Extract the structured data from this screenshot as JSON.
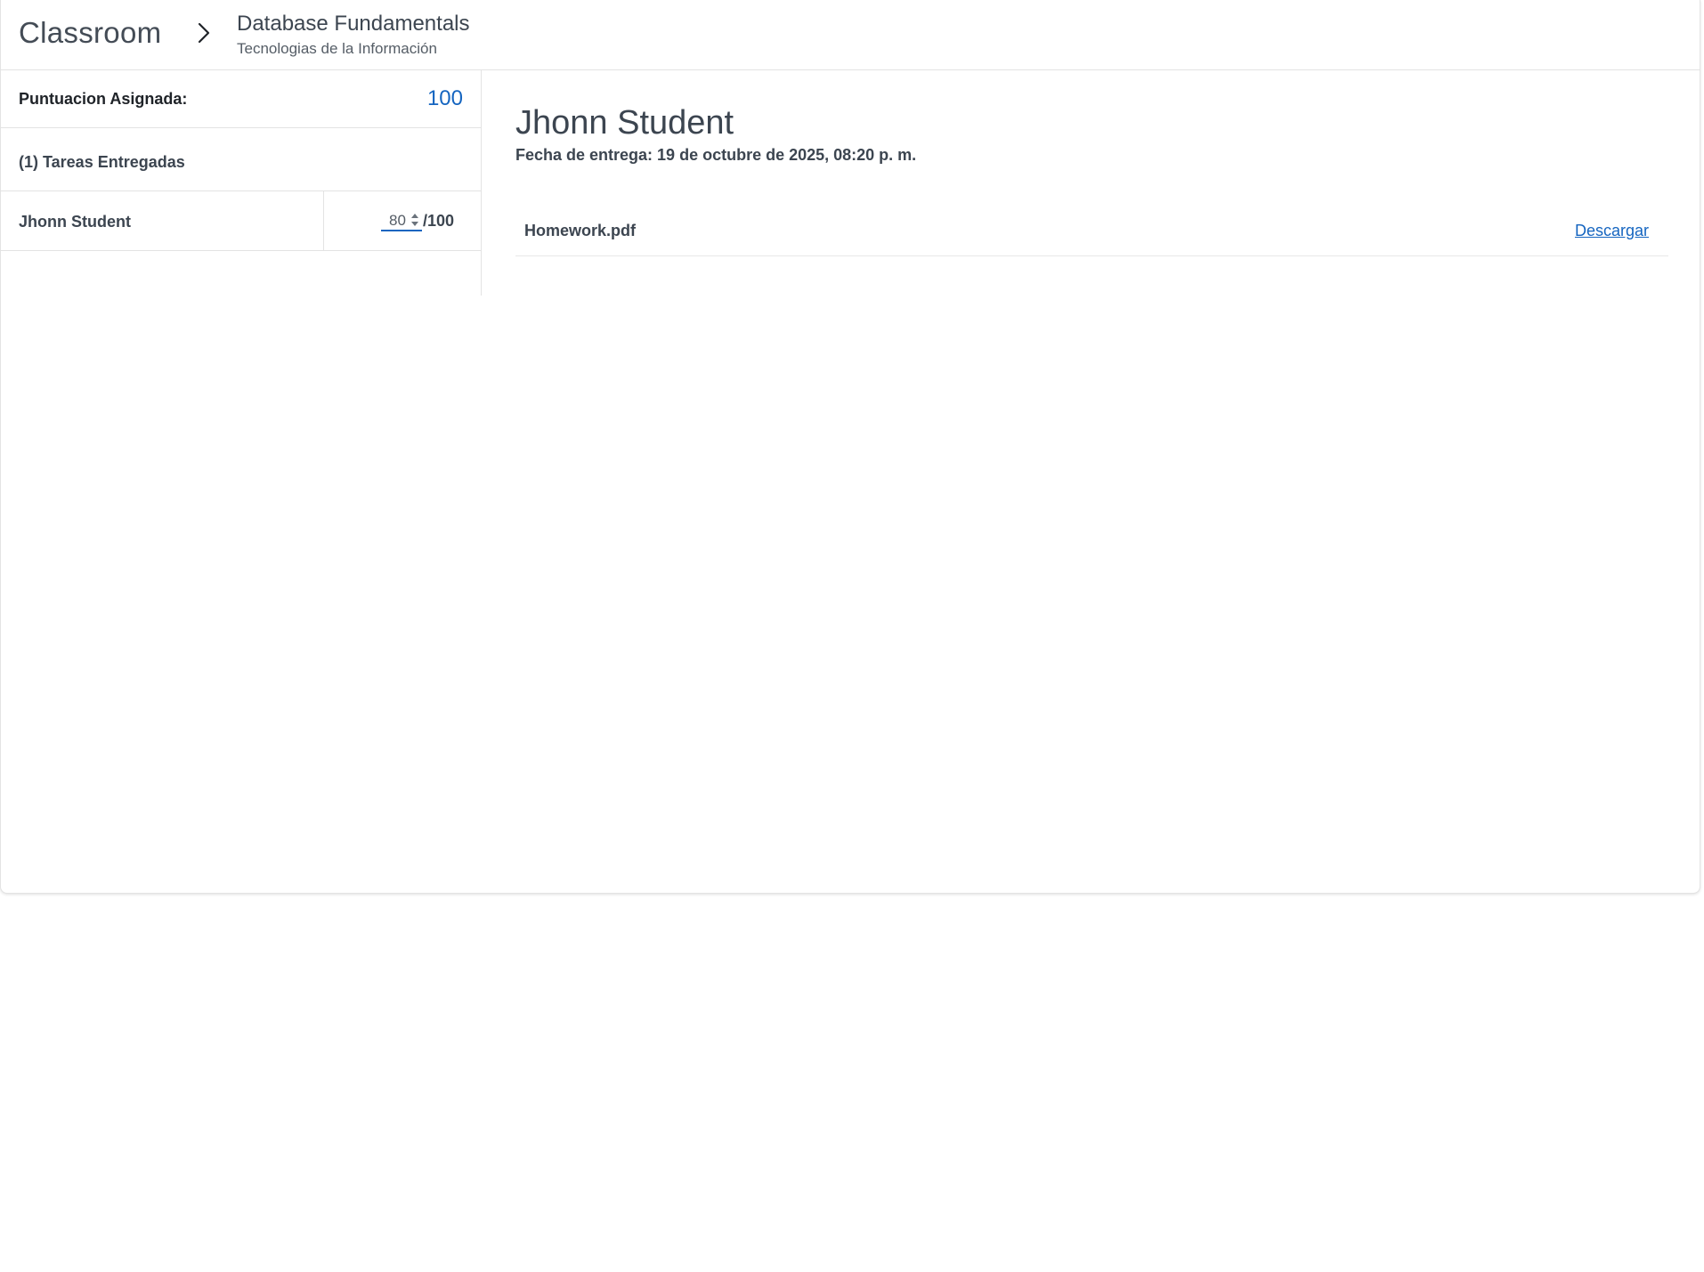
{
  "header": {
    "brand": "Classroom",
    "course_title": "Database Fundamentals",
    "course_subtitle": "Tecnologias de la Información"
  },
  "sidebar": {
    "score_label": "Puntuacion Asignada:",
    "score_value": "100",
    "submitted_label": "(1) Tareas Entregadas",
    "students": [
      {
        "name": "Jhonn Student",
        "grade": "80",
        "max": "/100"
      }
    ]
  },
  "main": {
    "student_name": "Jhonn Student",
    "due_date": "Fecha de entrega: 19 de octubre de 2025, 08:20 p. m.",
    "files": [
      {
        "name": "Homework.pdf",
        "action": "Descargar"
      }
    ]
  },
  "colors": {
    "accent": "#1565c0",
    "text": "#3c4550",
    "border": "#e3e3e3"
  }
}
